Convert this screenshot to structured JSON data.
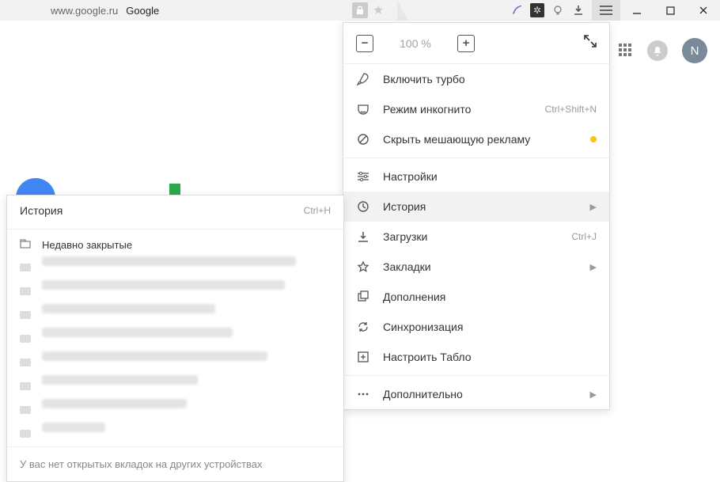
{
  "tab": {
    "url": "www.google.ru",
    "title": "Google"
  },
  "zoom": {
    "percent": "100 %"
  },
  "menu": {
    "turbo": "Включить турбо",
    "incognito": "Режим инкогнито",
    "incognito_shortcut": "Ctrl+Shift+N",
    "hide_ads": "Скрыть мешающую рекламу",
    "settings": "Настройки",
    "history": "История",
    "downloads": "Загрузки",
    "downloads_shortcut": "Ctrl+J",
    "bookmarks": "Закладки",
    "extensions": "Дополнения",
    "sync": "Синхронизация",
    "custom_tabloid": "Настроить Табло",
    "more": "Дополнительно"
  },
  "history_submenu": {
    "title": "История",
    "shortcut": "Ctrl+H",
    "recently_closed": "Недавно закрытые",
    "footer": "У вас нет открытых вкладок на других устройствах"
  },
  "avatar_initial": "N"
}
